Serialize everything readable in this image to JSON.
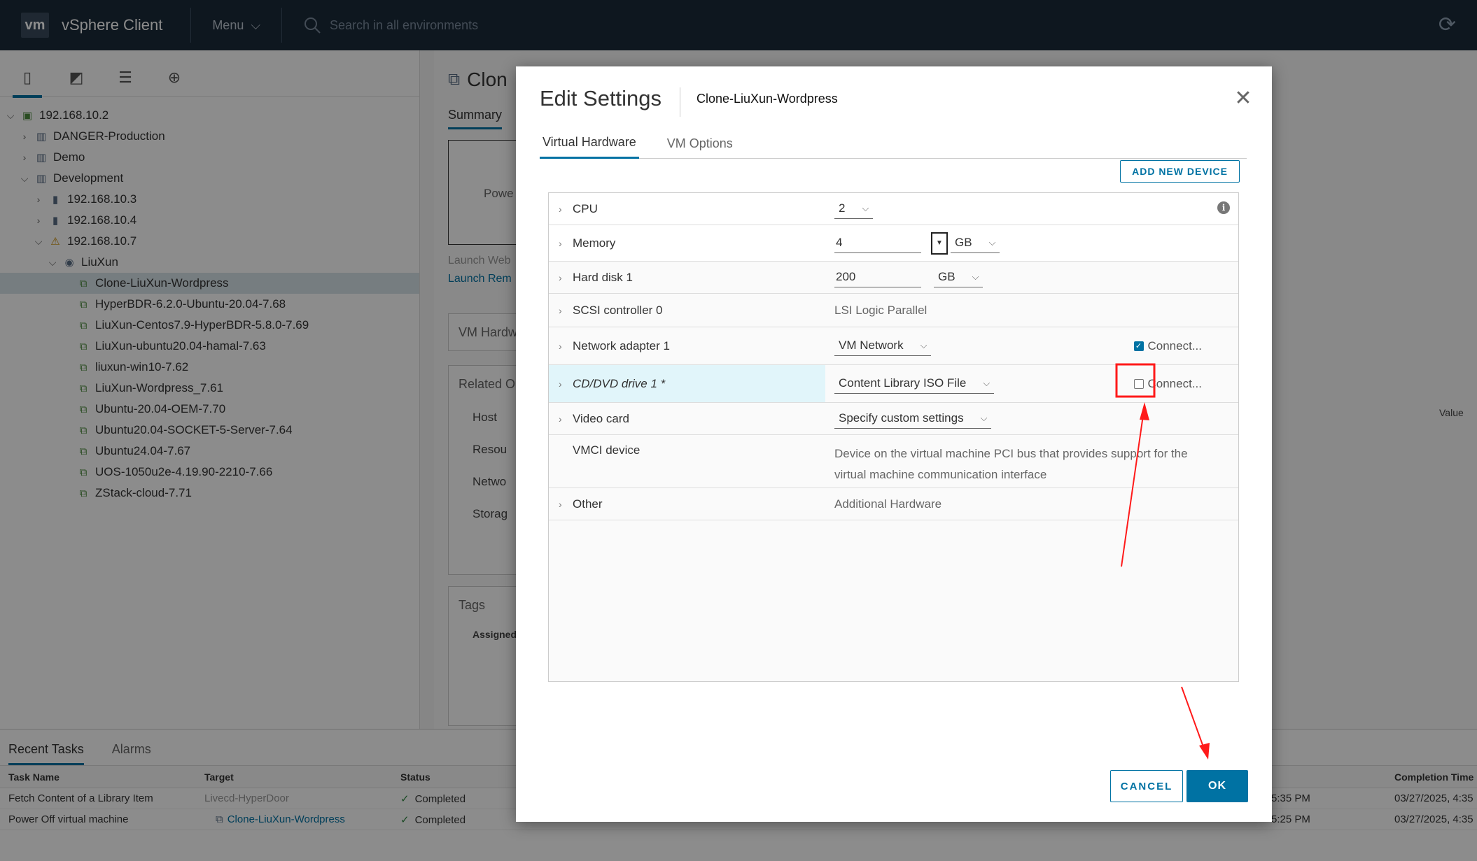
{
  "topbar": {
    "logo": "vm",
    "app_title": "vSphere Client",
    "menu_label": "Menu",
    "search_placeholder": "Search in all environments"
  },
  "tree": [
    {
      "label": "192.168.10.2",
      "level": 0,
      "expanded": true,
      "icon": "datacenter-icon"
    },
    {
      "label": "DANGER-Production",
      "level": 1,
      "expanded": false,
      "icon": "cluster-icon"
    },
    {
      "label": "Demo",
      "level": 1,
      "expanded": false,
      "icon": "cluster-icon"
    },
    {
      "label": "Development",
      "level": 1,
      "expanded": true,
      "icon": "cluster-icon"
    },
    {
      "label": "192.168.10.3",
      "level": 2,
      "expanded": false,
      "icon": "host-icon"
    },
    {
      "label": "192.168.10.4",
      "level": 2,
      "expanded": false,
      "icon": "host-icon"
    },
    {
      "label": "192.168.10.7",
      "level": 2,
      "expanded": true,
      "icon": "host-warning-icon"
    },
    {
      "label": "LiuXun",
      "level": 3,
      "expanded": true,
      "icon": "resource-pool-icon"
    },
    {
      "label": "Clone-LiuXun-Wordpress",
      "level": 4,
      "selected": true,
      "icon": "vm-icon"
    },
    {
      "label": "HyperBDR-6.2.0-Ubuntu-20.04-7.68",
      "level": 4,
      "icon": "vm-icon"
    },
    {
      "label": "LiuXun-Centos7.9-HyperBDR-5.8.0-7.69",
      "level": 4,
      "icon": "vm-icon"
    },
    {
      "label": "LiuXun-ubuntu20.04-hamal-7.63",
      "level": 4,
      "icon": "vm-icon"
    },
    {
      "label": "liuxun-win10-7.62",
      "level": 4,
      "icon": "vm-icon"
    },
    {
      "label": "LiuXun-Wordpress_7.61",
      "level": 4,
      "icon": "vm-icon"
    },
    {
      "label": "Ubuntu-20.04-OEM-7.70",
      "level": 4,
      "icon": "vm-icon"
    },
    {
      "label": "Ubuntu20.04-SOCKET-5-Server-7.64",
      "level": 4,
      "icon": "vm-icon"
    },
    {
      "label": "Ubuntu24.04-7.67",
      "level": 4,
      "icon": "vm-icon"
    },
    {
      "label": "UOS-1050u2e-4.19.90-2210-7.66",
      "level": 4,
      "icon": "vm-icon"
    },
    {
      "label": "ZStack-cloud-7.71",
      "level": 4,
      "icon": "vm-icon"
    }
  ],
  "background": {
    "title": "Clon",
    "summary_tab": "Summary",
    "power_text": "Powe",
    "launch_web": "Launch Web",
    "launch_remote": "Launch Rem",
    "vm_hardware": "VM Hardw",
    "related_objects": "Related O",
    "related_rows": [
      "Host",
      "Resou",
      "Netwo",
      "Storag"
    ],
    "tags": "Tags",
    "assigned": "Assigned",
    "value_header": "Value"
  },
  "tasks": {
    "tabs": [
      "Recent Tasks",
      "Alarms"
    ],
    "columns": {
      "task_name": "Task Name",
      "target": "Target",
      "status": "Status",
      "completion": "Completion Time"
    },
    "rows": [
      {
        "task": "Fetch Content of a Library Item",
        "target": "Livecd-HyperDoor",
        "status": "Completed",
        "time_frag": "5:35 PM",
        "completion": "03/27/2025, 4:35"
      },
      {
        "task": "Power Off virtual machine",
        "target": "Clone-LiuXun-Wordpress",
        "status": "Completed",
        "time_frag": "5:25 PM",
        "completion": "03/27/2025, 4:35"
      }
    ]
  },
  "modal": {
    "title": "Edit Settings",
    "subtitle": "Clone-LiuXun-Wordpress",
    "tabs": [
      "Virtual Hardware",
      "VM Options"
    ],
    "add_device": "ADD NEW DEVICE",
    "cpu": {
      "label": "CPU",
      "value": "2"
    },
    "memory": {
      "label": "Memory",
      "value": "4",
      "unit": "GB"
    },
    "hard_disk": {
      "label": "Hard disk 1",
      "value": "200",
      "unit": "GB"
    },
    "scsi": {
      "label": "SCSI controller 0",
      "value": "LSI Logic Parallel"
    },
    "network": {
      "label": "Network adapter 1",
      "value": "VM Network",
      "connect_label": "Connect...",
      "connected": true
    },
    "cdrom": {
      "label": "CD/DVD drive 1 *",
      "value": "Content Library ISO File",
      "connect_label": "Connect...",
      "connected": false
    },
    "video": {
      "label": "Video card",
      "value": "Specify custom settings"
    },
    "vmci": {
      "label": "VMCI device",
      "value_line1": "Device on the virtual machine PCI bus that provides support for the",
      "value_line2": "virtual machine communication interface"
    },
    "other": {
      "label": "Other",
      "value": "Additional Hardware"
    },
    "cancel": "CANCEL",
    "ok": "OK"
  },
  "colors": {
    "accent": "#0072a3",
    "topbar": "#1b2a39",
    "annotation": "#ff1a1a",
    "highlight": "#e1f5fa"
  }
}
